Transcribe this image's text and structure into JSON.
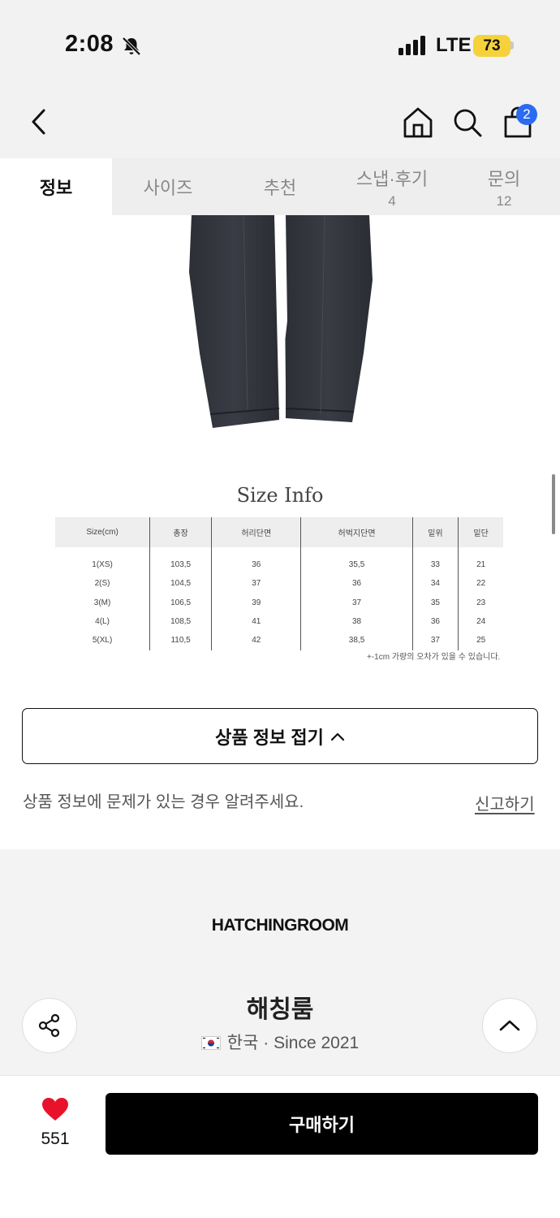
{
  "status_bar": {
    "time": "2:08",
    "network": "LTE",
    "battery": "73",
    "icons": [
      "bell-slash-icon",
      "signal-icon",
      "battery-icon"
    ]
  },
  "nav": {
    "icons": [
      "chevron-left-icon",
      "home-icon",
      "search-icon",
      "shopping-bag-icon"
    ],
    "cart_count": "2"
  },
  "tabs": [
    {
      "label": "정보",
      "count": ""
    },
    {
      "label": "사이즈",
      "count": ""
    },
    {
      "label": "추천",
      "count": ""
    },
    {
      "label": "스냅·후기",
      "count": "4"
    },
    {
      "label": "문의",
      "count": "12"
    }
  ],
  "size_info": {
    "title": "Size Info",
    "headers": [
      "Size(cm)",
      "총장",
      "허리단면",
      "허벅지단면",
      "밑위",
      "밑단"
    ],
    "rows": [
      [
        "1(XS)",
        "103,5",
        "36",
        "35,5",
        "33",
        "21"
      ],
      [
        "2(S)",
        "104,5",
        "37",
        "36",
        "34",
        "22"
      ],
      [
        "3(M)",
        "106,5",
        "39",
        "37",
        "35",
        "23"
      ],
      [
        "4(L)",
        "108,5",
        "41",
        "38",
        "36",
        "24"
      ],
      [
        "5(XL)",
        "110,5",
        "42",
        "38,5",
        "37",
        "25"
      ]
    ],
    "note": "+-1cm 가량의 오차가 있을 수 있습니다."
  },
  "collapse_button": "상품 정보 접기",
  "report": {
    "text": "상품 정보에 문제가 있는 경우 알려주세요.",
    "link": "신고하기"
  },
  "brand": {
    "logo": "HATCHINGROOM",
    "name": "해칭룸",
    "meta": "한국 · Since 2021"
  },
  "bottom": {
    "likes": "551",
    "buy_label": "구매하기"
  },
  "colors": {
    "accent_badge": "#2a6bf2",
    "heart": "#e8132b",
    "battery": "#f5d23b",
    "buy_button": "#000000"
  }
}
